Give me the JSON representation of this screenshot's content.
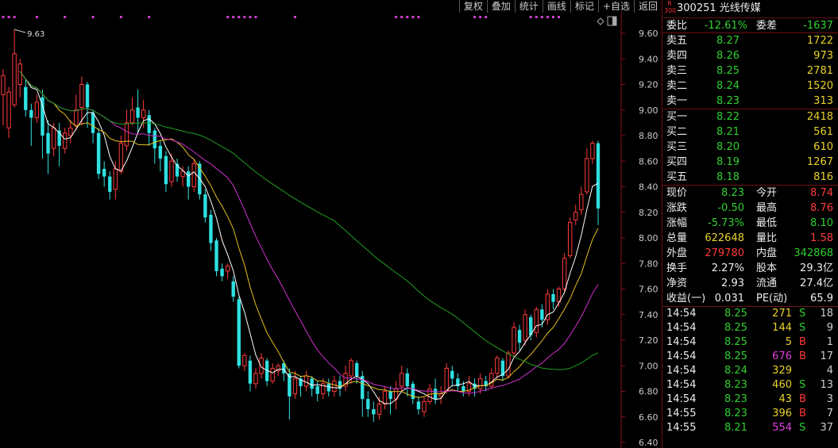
{
  "toolbar": [
    "复权",
    "叠加",
    "统计",
    "画线",
    "标记",
    "+自选",
    "返回"
  ],
  "stock": {
    "tag_top": "R",
    "tag_bottom": "300",
    "code": "300251",
    "name": "光线传媒"
  },
  "commission": {
    "ratio_label": "委比",
    "ratio": "-12.61%",
    "diff_label": "委差",
    "diff": "-1637"
  },
  "asks": [
    {
      "label": "卖五",
      "price": "8.27",
      "vol": "1722"
    },
    {
      "label": "卖四",
      "price": "8.26",
      "vol": "973"
    },
    {
      "label": "卖三",
      "price": "8.25",
      "vol": "2781"
    },
    {
      "label": "卖二",
      "price": "8.24",
      "vol": "1520"
    },
    {
      "label": "卖一",
      "price": "8.23",
      "vol": "313"
    }
  ],
  "bids": [
    {
      "label": "买一",
      "price": "8.22",
      "vol": "2418"
    },
    {
      "label": "买二",
      "price": "8.21",
      "vol": "561"
    },
    {
      "label": "买三",
      "price": "8.20",
      "vol": "610"
    },
    {
      "label": "买四",
      "price": "8.19",
      "vol": "1267"
    },
    {
      "label": "买五",
      "price": "8.18",
      "vol": "816"
    }
  ],
  "stats": [
    {
      "l1": "现价",
      "v1": "8.23",
      "c1": "green",
      "l2": "今开",
      "v2": "8.74",
      "c2": "red"
    },
    {
      "l1": "涨跌",
      "v1": "-0.50",
      "c1": "green",
      "l2": "最高",
      "v2": "8.76",
      "c2": "red"
    },
    {
      "l1": "涨幅",
      "v1": "-5.73%",
      "c1": "green",
      "l2": "最低",
      "v2": "8.10",
      "c2": "green"
    },
    {
      "l1": "总量",
      "v1": "622648",
      "c1": "yellow",
      "l2": "量比",
      "v2": "1.58",
      "c2": "red"
    },
    {
      "l1": "外盘",
      "v1": "279780",
      "c1": "red",
      "l2": "内盘",
      "v2": "342868",
      "c2": "green"
    },
    {
      "l1": "换手",
      "v1": "2.27%",
      "c1": "white",
      "l2": "股本",
      "v2": "29.3亿",
      "c2": "white"
    },
    {
      "l1": "净资",
      "v1": "2.93",
      "c1": "white",
      "l2": "流通",
      "v2": "27.4亿",
      "c2": "white"
    },
    {
      "l1": "收益(一)",
      "v1": "0.031",
      "c1": "white",
      "l2": "PE(动)",
      "v2": "65.9",
      "c2": "white"
    }
  ],
  "trades": [
    {
      "time": "14:54",
      "price": "8.25",
      "pc": "green",
      "vol": "271",
      "vc": "yellow",
      "bs": "S",
      "bc": "green",
      "cnt": "18"
    },
    {
      "time": "14:54",
      "price": "8.25",
      "pc": "green",
      "vol": "144",
      "vc": "yellow",
      "bs": "S",
      "bc": "green",
      "cnt": "9"
    },
    {
      "time": "14:54",
      "price": "8.25",
      "pc": "green",
      "vol": "5",
      "vc": "yellow",
      "bs": "B",
      "bc": "red",
      "cnt": "1"
    },
    {
      "time": "14:54",
      "price": "8.25",
      "pc": "green",
      "vol": "676",
      "vc": "magenta",
      "bs": "B",
      "bc": "red",
      "cnt": "17"
    },
    {
      "time": "14:54",
      "price": "8.24",
      "pc": "green",
      "vol": "329",
      "vc": "yellow",
      "bs": "",
      "bc": "white",
      "cnt": "4"
    },
    {
      "time": "14:54",
      "price": "8.23",
      "pc": "green",
      "vol": "460",
      "vc": "yellow",
      "bs": "S",
      "bc": "green",
      "cnt": "13"
    },
    {
      "time": "14:54",
      "price": "8.23",
      "pc": "green",
      "vol": "43",
      "vc": "yellow",
      "bs": "B",
      "bc": "red",
      "cnt": "3"
    },
    {
      "time": "14:55",
      "price": "8.23",
      "pc": "green",
      "vol": "396",
      "vc": "yellow",
      "bs": "B",
      "bc": "red",
      "cnt": "7"
    },
    {
      "time": "14:55",
      "price": "8.21",
      "pc": "green",
      "vol": "554",
      "vc": "magenta",
      "bs": "S",
      "bc": "green",
      "cnt": "37"
    }
  ],
  "chart_data": {
    "type": "candlestick",
    "y_ticks": [
      "9.60",
      "9.40",
      "9.20",
      "9.00",
      "8.80",
      "8.60",
      "8.40",
      "8.20",
      "8.00",
      "7.80",
      "7.60",
      "7.40",
      "7.20",
      "7.00",
      "6.80",
      "6.60",
      "6.40"
    ],
    "ylim": [
      6.4,
      9.6
    ],
    "max_label": "9.63",
    "colors": {
      "up": "#ff3b3b",
      "down": "#2fe0e0",
      "ma5": "#ffffff",
      "ma10": "#e6c020",
      "ma20": "#d030d0",
      "ma60": "#20a020",
      "grid": "#5a0a0a",
      "axis": "#8a1010",
      "signal": "#d040d0"
    },
    "candles": [
      [
        9.12,
        9.27,
        8.88,
        9.32
      ],
      [
        8.86,
        9.14,
        8.78,
        9.18
      ],
      [
        9.04,
        9.44,
        9.02,
        9.63
      ],
      [
        9.2,
        9.36,
        9.1,
        9.4
      ],
      [
        9.18,
        9.0,
        8.95,
        9.24
      ],
      [
        9.0,
        8.94,
        8.72,
        9.05
      ],
      [
        8.94,
        9.06,
        8.9,
        9.12
      ],
      [
        9.1,
        8.8,
        8.62,
        9.16
      ],
      [
        8.82,
        8.66,
        8.5,
        8.92
      ],
      [
        8.7,
        8.86,
        8.64,
        8.9
      ],
      [
        8.84,
        8.72,
        8.56,
        8.9
      ],
      [
        8.7,
        8.82,
        8.66,
        8.86
      ],
      [
        8.8,
        8.86,
        8.74,
        8.92
      ],
      [
        8.88,
        9.0,
        8.84,
        9.12
      ],
      [
        9.02,
        9.2,
        8.88,
        9.26
      ],
      [
        9.2,
        9.02,
        8.86,
        9.22
      ],
      [
        8.98,
        8.82,
        8.74,
        9.0
      ],
      [
        8.82,
        8.5,
        8.46,
        8.86
      ],
      [
        8.54,
        8.48,
        8.4,
        8.6
      ],
      [
        8.48,
        8.36,
        8.3,
        8.52
      ],
      [
        8.38,
        8.54,
        8.3,
        8.6
      ],
      [
        8.52,
        8.74,
        8.5,
        8.8
      ],
      [
        8.72,
        8.9,
        8.68,
        9.0
      ],
      [
        8.9,
        9.0,
        8.88,
        9.1
      ],
      [
        9.02,
        8.94,
        8.82,
        9.16
      ],
      [
        8.94,
        9.0,
        8.86,
        9.08
      ],
      [
        8.96,
        8.82,
        8.72,
        9.0
      ],
      [
        8.84,
        8.7,
        8.58,
        8.86
      ],
      [
        8.72,
        8.62,
        8.52,
        8.76
      ],
      [
        8.64,
        8.42,
        8.36,
        8.68
      ],
      [
        8.44,
        8.6,
        8.4,
        8.66
      ],
      [
        8.58,
        8.48,
        8.44,
        8.62
      ],
      [
        8.48,
        8.52,
        8.4,
        8.56
      ],
      [
        8.52,
        8.4,
        8.3,
        8.56
      ],
      [
        8.4,
        8.58,
        8.36,
        8.62
      ],
      [
        8.58,
        8.34,
        8.3,
        8.6
      ],
      [
        8.34,
        8.16,
        8.12,
        8.38
      ],
      [
        8.18,
        7.96,
        7.9,
        8.22
      ],
      [
        7.98,
        7.74,
        7.7,
        8.0
      ],
      [
        7.76,
        7.7,
        7.66,
        7.8
      ],
      [
        7.74,
        7.78,
        7.68,
        7.8
      ],
      [
        7.66,
        7.54,
        7.5,
        7.7
      ],
      [
        7.52,
        7.0,
        6.98,
        7.54
      ],
      [
        7.0,
        7.08,
        6.96,
        7.1
      ],
      [
        7.04,
        6.86,
        6.8,
        7.08
      ],
      [
        6.86,
        6.94,
        6.82,
        6.98
      ],
      [
        6.94,
        7.06,
        6.9,
        7.1
      ],
      [
        7.04,
        6.88,
        6.84,
        7.06
      ],
      [
        6.88,
        6.98,
        6.86,
        7.02
      ],
      [
        6.96,
        7.0,
        6.92,
        7.02
      ],
      [
        7.02,
        6.94,
        6.88,
        7.04
      ],
      [
        6.94,
        6.76,
        6.58,
        6.98
      ],
      [
        6.78,
        6.9,
        6.74,
        6.96
      ],
      [
        6.9,
        6.84,
        6.76,
        6.92
      ],
      [
        6.84,
        6.92,
        6.8,
        6.96
      ],
      [
        6.9,
        6.82,
        6.76,
        6.92
      ],
      [
        6.84,
        6.78,
        6.72,
        6.88
      ],
      [
        6.78,
        6.86,
        6.74,
        6.9
      ],
      [
        6.86,
        6.8,
        6.76,
        6.9
      ],
      [
        6.8,
        6.88,
        6.76,
        6.92
      ],
      [
        6.88,
        6.82,
        6.76,
        6.92
      ],
      [
        6.84,
        6.94,
        6.8,
        7.0
      ],
      [
        6.92,
        7.04,
        6.86,
        7.06
      ],
      [
        7.02,
        6.92,
        6.86,
        7.04
      ],
      [
        6.92,
        6.74,
        6.6,
        6.96
      ],
      [
        6.74,
        6.66,
        6.6,
        6.8
      ],
      [
        6.66,
        6.62,
        6.56,
        6.72
      ],
      [
        6.62,
        6.7,
        6.58,
        6.76
      ],
      [
        6.7,
        6.8,
        6.66,
        6.84
      ],
      [
        6.8,
        6.74,
        6.62,
        6.84
      ],
      [
        6.74,
        6.82,
        6.66,
        6.88
      ],
      [
        6.84,
        6.94,
        6.8,
        7.0
      ],
      [
        6.94,
        6.84,
        6.76,
        6.98
      ],
      [
        6.86,
        6.74,
        6.7,
        6.88
      ],
      [
        6.72,
        6.66,
        6.62,
        6.76
      ],
      [
        6.64,
        6.72,
        6.6,
        6.76
      ],
      [
        6.72,
        6.82,
        6.7,
        6.86
      ],
      [
        6.82,
        6.74,
        6.7,
        6.9
      ],
      [
        6.76,
        6.78,
        6.7,
        6.84
      ],
      [
        6.8,
        6.98,
        6.78,
        7.02
      ],
      [
        6.96,
        6.9,
        6.84,
        7.0
      ],
      [
        6.9,
        6.84,
        6.8,
        6.94
      ],
      [
        6.84,
        6.8,
        6.76,
        6.88
      ],
      [
        6.8,
        6.86,
        6.76,
        6.92
      ],
      [
        6.86,
        6.82,
        6.76,
        6.9
      ],
      [
        6.82,
        6.9,
        6.78,
        6.94
      ],
      [
        6.88,
        6.84,
        6.8,
        6.92
      ],
      [
        6.84,
        6.94,
        6.82,
        6.98
      ],
      [
        6.94,
        7.06,
        6.9,
        7.08
      ],
      [
        7.04,
        6.92,
        6.88,
        7.06
      ],
      [
        6.92,
        7.1,
        6.9,
        7.12
      ],
      [
        7.1,
        7.3,
        7.06,
        7.34
      ],
      [
        7.28,
        7.18,
        7.12,
        7.32
      ],
      [
        7.2,
        7.4,
        7.16,
        7.44
      ],
      [
        7.38,
        7.24,
        7.2,
        7.4
      ],
      [
        7.26,
        7.44,
        7.22,
        7.46
      ],
      [
        7.44,
        7.36,
        7.3,
        7.48
      ],
      [
        7.36,
        7.56,
        7.32,
        7.6
      ],
      [
        7.56,
        7.5,
        7.44,
        7.6
      ],
      [
        7.5,
        7.6,
        7.46,
        7.62
      ],
      [
        7.6,
        7.84,
        7.58,
        7.88
      ],
      [
        7.86,
        8.12,
        7.84,
        8.16
      ],
      [
        8.14,
        8.2,
        8.1,
        8.26
      ],
      [
        8.22,
        8.34,
        8.18,
        8.4
      ],
      [
        8.36,
        8.62,
        8.34,
        8.7
      ],
      [
        8.62,
        8.74,
        8.58,
        8.76
      ],
      [
        8.74,
        8.23,
        8.1,
        8.76
      ]
    ]
  }
}
